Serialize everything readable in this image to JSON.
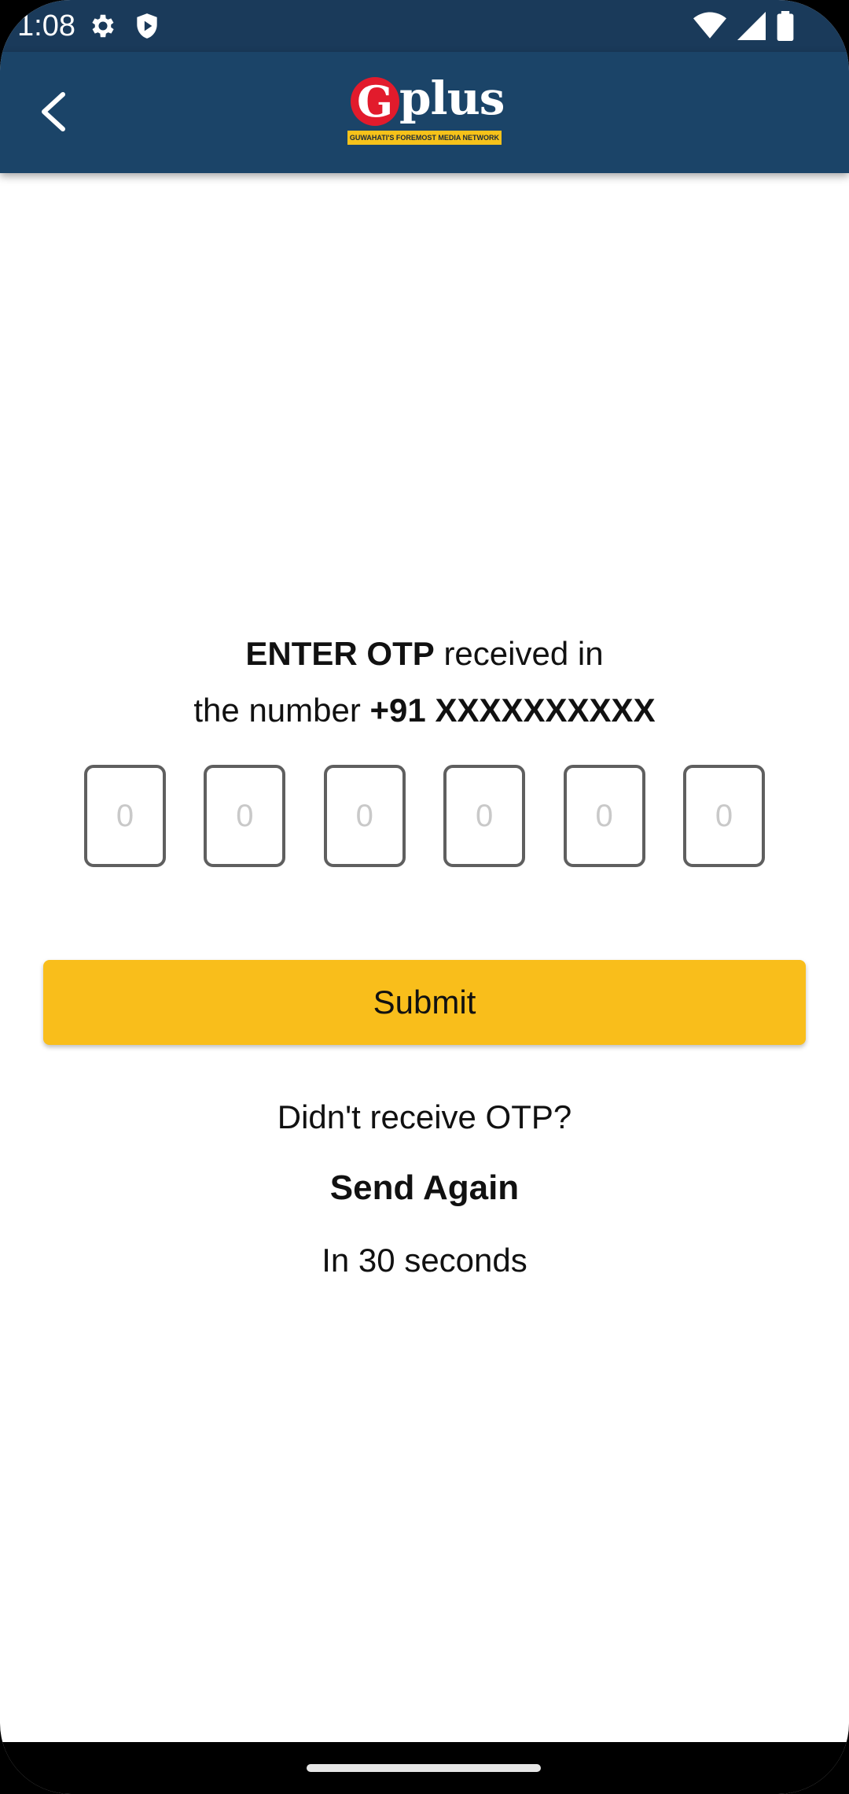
{
  "status_bar": {
    "time": "1:08",
    "icons_left": [
      "settings-icon",
      "shield-icon"
    ],
    "icons_right": [
      "wifi-icon",
      "signal-icon",
      "battery-icon"
    ]
  },
  "app_bar": {
    "back_icon": "back-arrow-icon",
    "logo_g": "G",
    "logo_text": "plus",
    "logo_tagline": "GUWAHATI'S FOREMOST MEDIA NETWORK"
  },
  "otp": {
    "heading_bold": "ENTER OTP",
    "heading_rest": " received in",
    "line2_prefix": "the number ",
    "phone_number": "+91 XXXXXXXXXX",
    "digit_placeholder": "0"
  },
  "submit_label": "Submit",
  "resend": {
    "question": "Didn't receive OTP?",
    "action": "Send Again",
    "countdown": "In 30 seconds"
  },
  "colors": {
    "status_bar": "#1a3a5a",
    "app_bar": "#1b4468",
    "submit": "#f9be1b",
    "logo_red": "#e21b2c"
  }
}
